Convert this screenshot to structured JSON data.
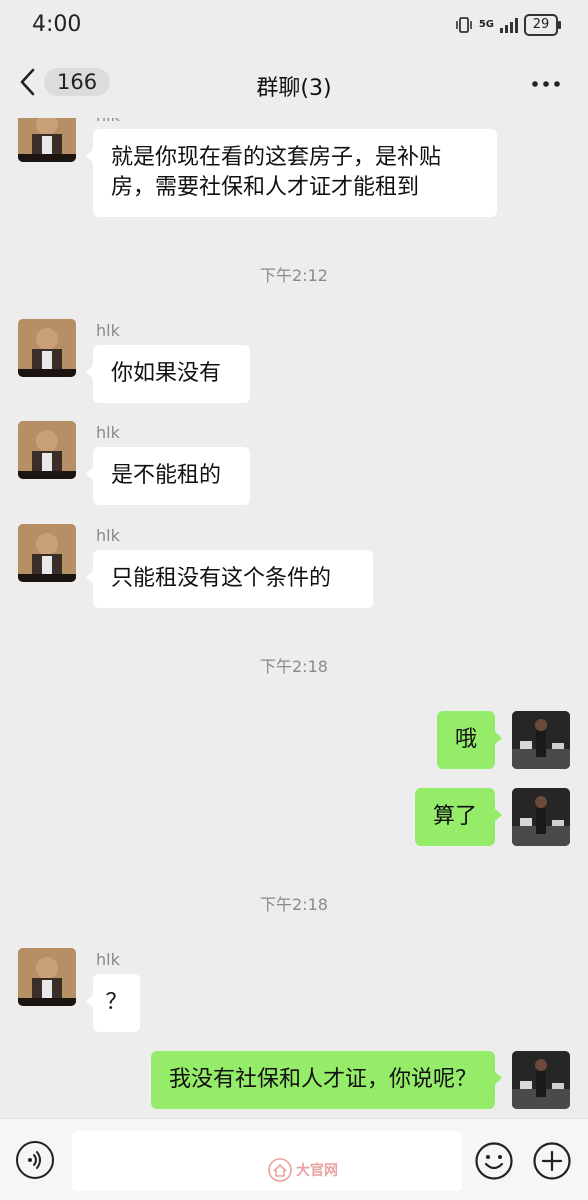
{
  "status_bar": {
    "time": "4:00",
    "network": "5G",
    "battery": "29"
  },
  "nav": {
    "back_count": "166",
    "title": "群聊(3)"
  },
  "messages": [
    {
      "side": "left",
      "sender": "hlk",
      "lines": [
        "就是你现在看的这套房子，是补贴",
        "房，需要社保和人才证才能租到"
      ]
    },
    {
      "type": "timestamp",
      "text": "下午2:12"
    },
    {
      "side": "left",
      "sender": "hlk",
      "lines": [
        "你如果没有"
      ]
    },
    {
      "side": "left",
      "sender": "hlk",
      "lines": [
        "是不能租的"
      ]
    },
    {
      "side": "left",
      "sender": "hlk",
      "lines": [
        "只能租没有这个条件的"
      ]
    },
    {
      "type": "timestamp",
      "text": "下午2:18"
    },
    {
      "side": "right",
      "lines": [
        "哦"
      ]
    },
    {
      "side": "right",
      "lines": [
        "算了"
      ]
    },
    {
      "type": "timestamp",
      "text": "下午2:18"
    },
    {
      "side": "left",
      "sender": "hlk",
      "lines": [
        "？"
      ]
    },
    {
      "side": "right",
      "lines": [
        "我没有社保和人才证，你说呢？"
      ]
    }
  ],
  "watermark": "大官网",
  "colors": {
    "background": "#ededed",
    "own_bubble": "#95ec69",
    "other_bubble": "#ffffff",
    "meta_text": "#8a8a8a"
  }
}
